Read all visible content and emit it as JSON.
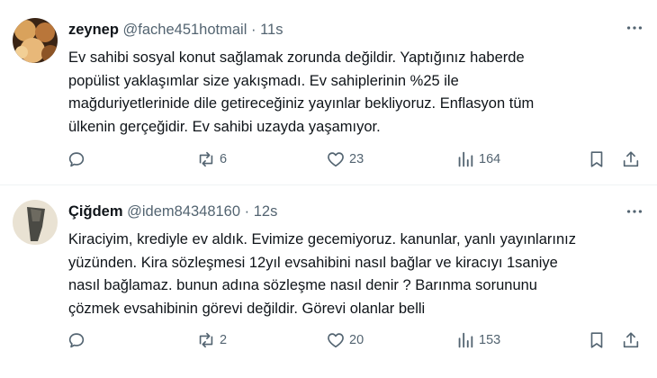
{
  "tweets": [
    {
      "name": "zeynep",
      "handle": "@fache451hotmail",
      "dot": "·",
      "time": "11s",
      "text_lines": [
        "Ev sahibi sosyal konut sağlamak zorunda değildir. Yaptığınız haberde",
        "popülist yaklaşımlar size yakışmadı. Ev sahiplerinin %25 ile",
        "mağduriyetlerinide dile getireceğiniz yayınlar bekliyoruz. Enflasyon tüm",
        "ülkenin gerçeğidir. Ev sahibi uzayda yaşamıyor."
      ],
      "reposts": "6",
      "likes": "23",
      "views": "164"
    },
    {
      "name": "Çiğdem",
      "handle": "@idem84348160",
      "dot": "·",
      "time": "12s",
      "text_lines": [
        "Kiraciyim, krediyle ev aldık. Evimize gecemiyoruz. kanunlar, yanlı yayınlarınız",
        "yüzünden. Kira sözleşmesi 12yıl evsahibini nasıl bağlar ve kiracıyı 1saniye",
        "nasıl bağlamaz. bunun adına sözleşme nasıl denir ? Barınma sorununu",
        "çözmek evsahibinin görevi değildir. Görevi olanlar belli"
      ],
      "reposts": "2",
      "likes": "20",
      "views": "153"
    }
  ],
  "icons": {
    "more": "more-dots-icon",
    "reply": "reply-icon",
    "repost": "repost-icon",
    "like": "heart-icon",
    "views": "views-icon",
    "bookmark": "bookmark-icon",
    "share": "share-icon"
  },
  "colors": {
    "text": "#0f1419",
    "secondary": "#536471",
    "divider": "#eff3f4"
  }
}
